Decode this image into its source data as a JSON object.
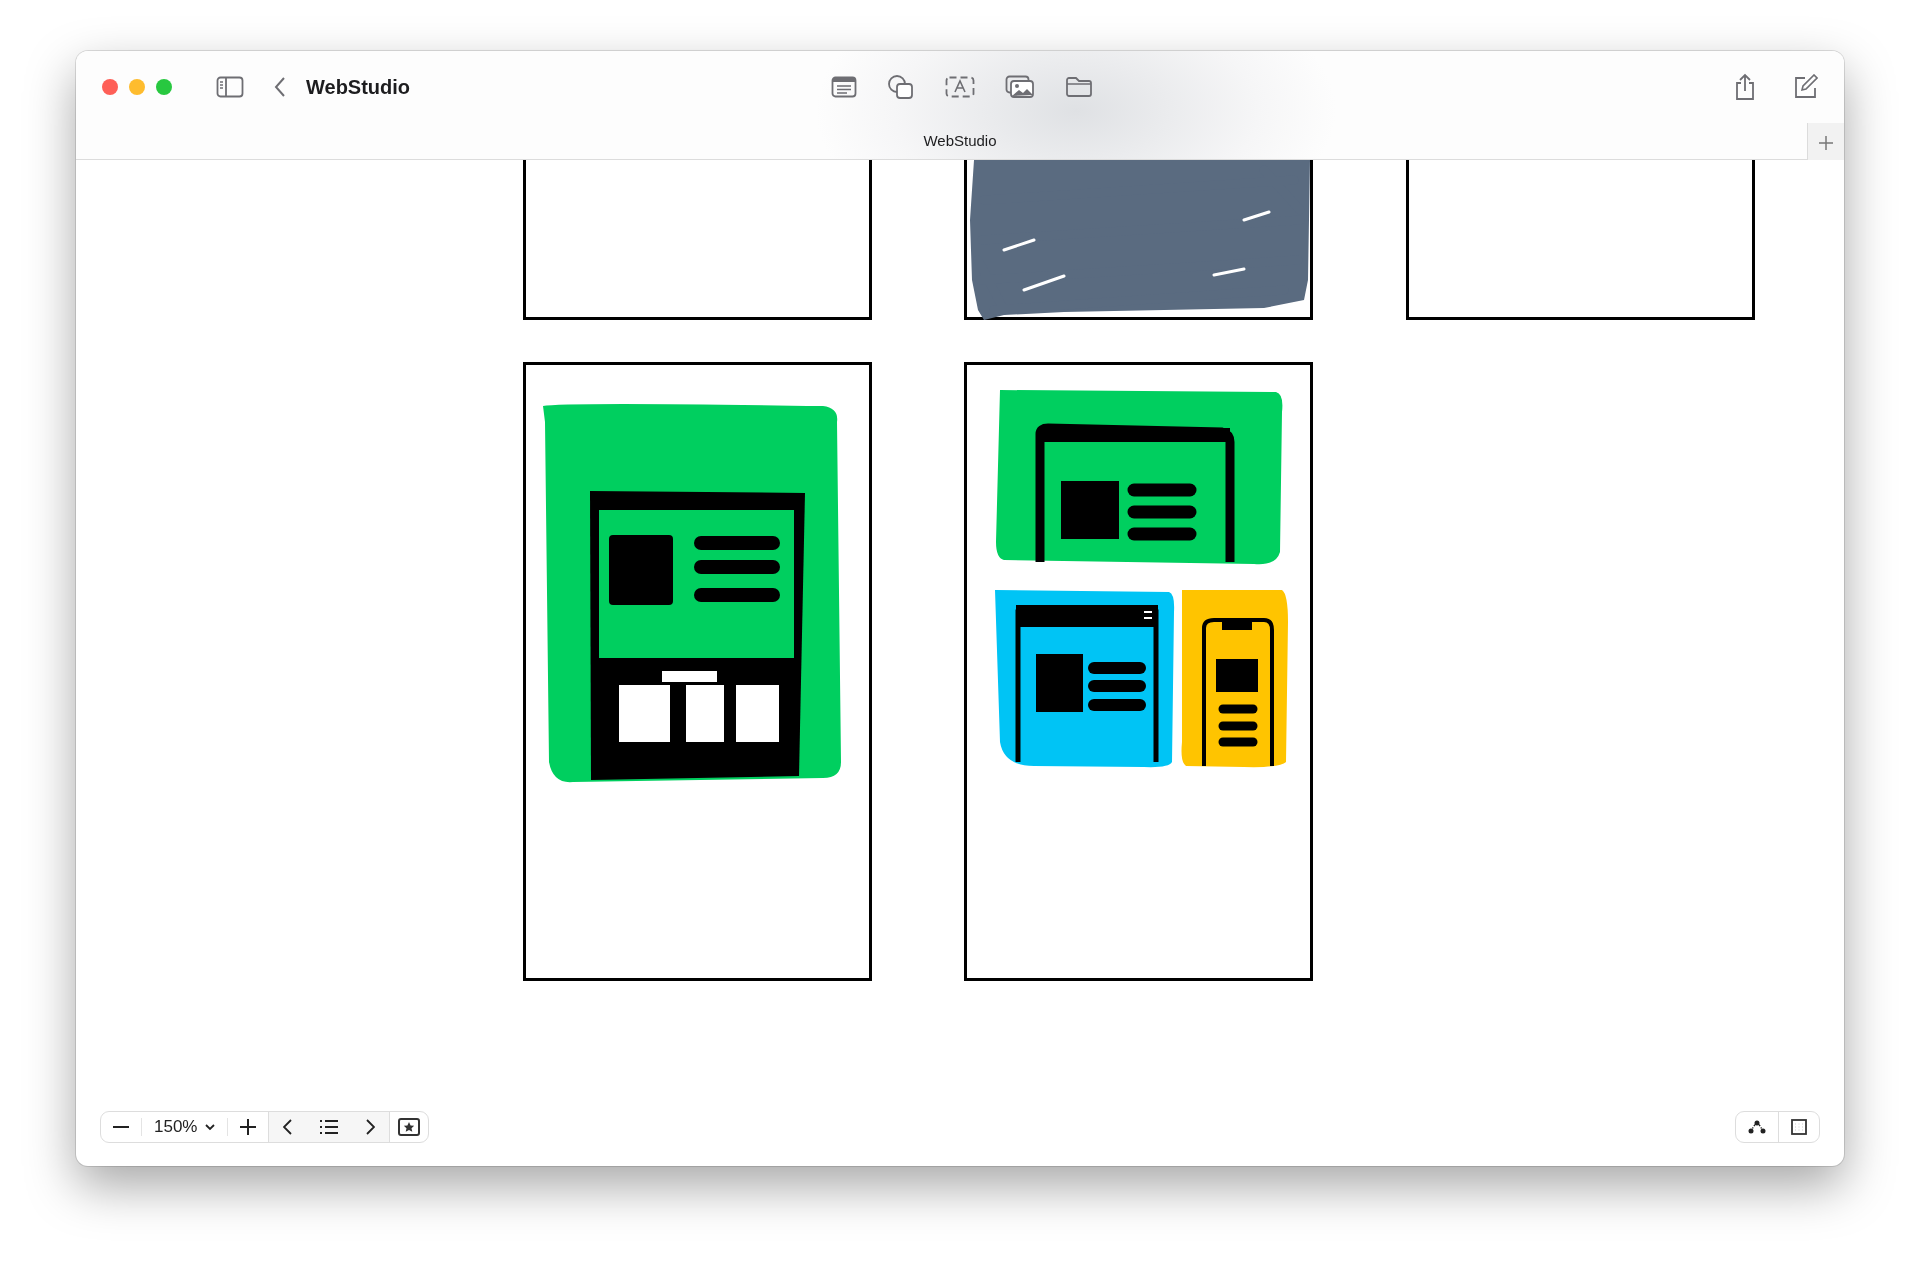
{
  "window": {
    "title": "WebStudio"
  },
  "tab": {
    "label": "WebStudio"
  },
  "canvas": {
    "top_row": [
      {
        "kind": "blank"
      },
      {
        "kind": "scribble"
      },
      {
        "kind": "blank"
      }
    ],
    "bottom_row": [
      {
        "kind": "page-sketch"
      },
      {
        "kind": "layout-sketch"
      }
    ]
  },
  "zoom_bar": {
    "level": "150%"
  }
}
